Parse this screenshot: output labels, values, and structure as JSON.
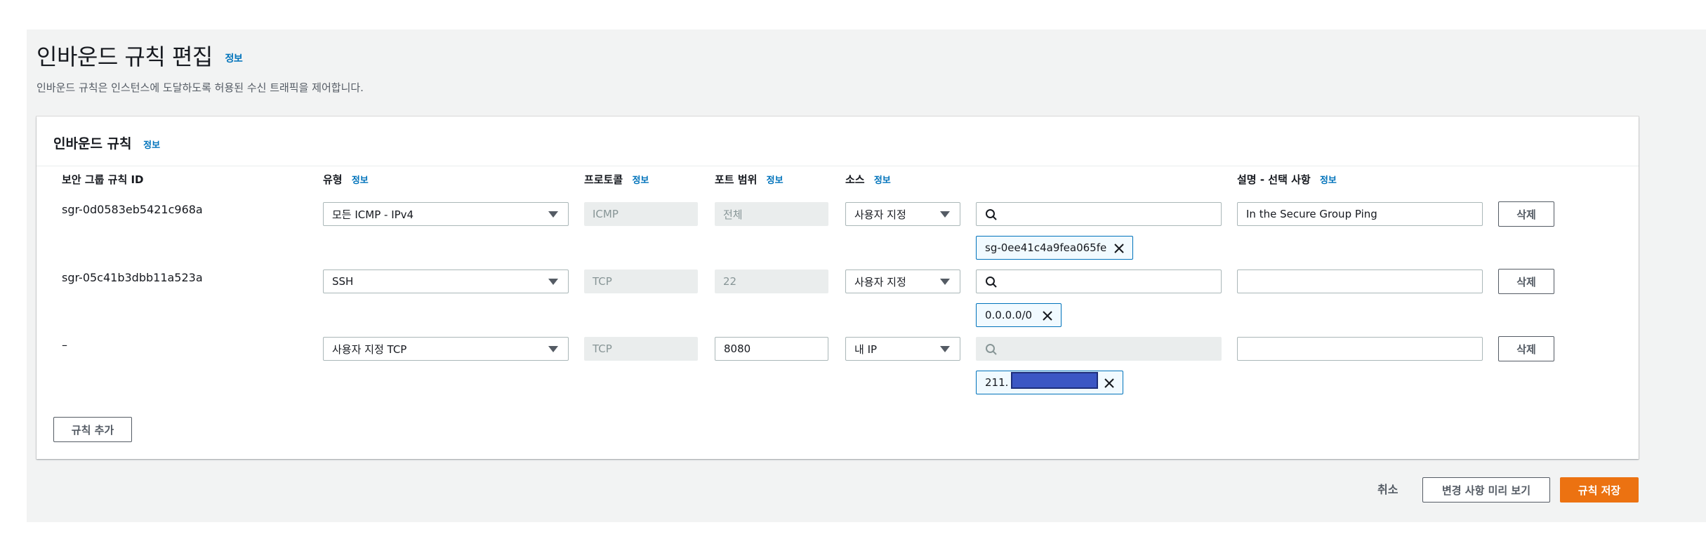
{
  "header": {
    "title": "인바운드 규칙 편집",
    "info": "정보",
    "subtitle": "인바운드 규칙은 인스턴스에 도달하도록 허용된 수신 트래픽을 제어합니다."
  },
  "panel": {
    "title": "인바운드 규칙",
    "info": "정보"
  },
  "columns": {
    "rule_id": "보안 그룹 규칙 ID",
    "type": "유형",
    "protocol": "프로토콜",
    "port_range": "포트 범위",
    "source": "소스",
    "description": "설명 - 선택 사항",
    "info": "정보"
  },
  "rules": [
    {
      "id": "sgr-0d0583eb5421c968a",
      "type": "모든 ICMP - IPv4",
      "protocol": "ICMP",
      "port_range": "전체",
      "source_type": "사용자 지정",
      "search_value": "",
      "token": "sg-0ee41c4a9fea065fe",
      "description": "In the Secure Group Ping",
      "delete_label": "삭제"
    },
    {
      "id": "sgr-05c41b3dbb11a523a",
      "type": "SSH",
      "protocol": "TCP",
      "port_range": "22",
      "source_type": "사용자 지정",
      "search_value": "",
      "token": "0.0.0.0/0",
      "description": "",
      "delete_label": "삭제"
    },
    {
      "id": "–",
      "type": "사용자 지정 TCP",
      "protocol": "TCP",
      "port_range": "8080",
      "source_type": "내 IP",
      "search_value": "",
      "token": "211.",
      "description": "",
      "delete_label": "삭제"
    }
  ],
  "add_rule_label": "규칙 추가",
  "footer": {
    "cancel": "취소",
    "preview": "변경 사항 미리 보기",
    "save": "규칙 저장"
  },
  "colors": {
    "accent": "#ec7211",
    "link": "#0073bb",
    "token_border": "#0073bb",
    "token_bg": "#f1faff"
  },
  "icons": [
    "search-icon",
    "close-icon",
    "caret-down-icon"
  ]
}
